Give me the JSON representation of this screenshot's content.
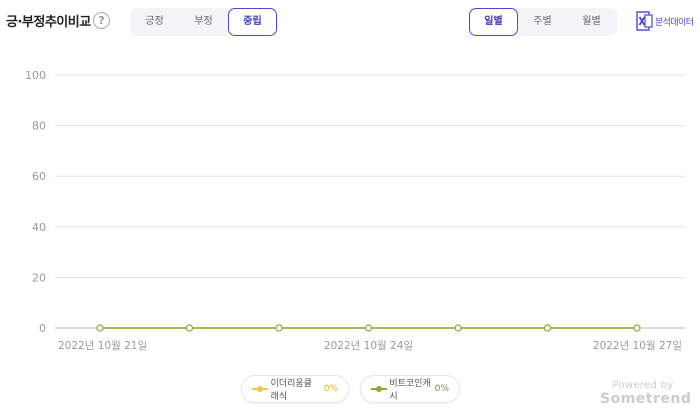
{
  "header": {
    "title": "긍·부정추이비교",
    "help_icon": "?"
  },
  "sentiment_tabs": [
    {
      "label": "긍정",
      "active": false
    },
    {
      "label": "부정",
      "active": false
    },
    {
      "label": "중립",
      "active": true
    }
  ],
  "period_tabs": [
    {
      "label": "일별",
      "active": true
    },
    {
      "label": "주별",
      "active": false
    },
    {
      "label": "월별",
      "active": false
    }
  ],
  "export": {
    "label": "분석데이터",
    "icon": "excel-icon"
  },
  "legend": [
    {
      "name": "이더리움클래식",
      "value": "0%",
      "color": "#f2c744"
    },
    {
      "name": "비트코인캐시",
      "value": "0%",
      "color": "#8fa83b"
    }
  ],
  "branding": {
    "powered_by": "Powered by",
    "brand": "Sometrend"
  },
  "chart_data": {
    "type": "line",
    "x": [
      "2022-10-21",
      "2022-10-22",
      "2022-10-23",
      "2022-10-24",
      "2022-10-25",
      "2022-10-26",
      "2022-10-27"
    ],
    "x_tick_labels": [
      "2022년 10월 21일",
      "2022년 10월 24일",
      "2022년 10월 27일"
    ],
    "y_ticks": [
      0,
      20,
      40,
      60,
      80,
      100
    ],
    "ylim": [
      0,
      100
    ],
    "grid": true,
    "legend_position": "bottom",
    "series": [
      {
        "name": "이더리움클래식",
        "color": "#f2c744",
        "values": [
          0,
          0,
          0,
          0,
          0,
          0,
          0
        ]
      },
      {
        "name": "비트코인캐시",
        "color": "#8fa83b",
        "values": [
          0,
          0,
          0,
          0,
          0,
          0,
          0
        ]
      }
    ]
  }
}
